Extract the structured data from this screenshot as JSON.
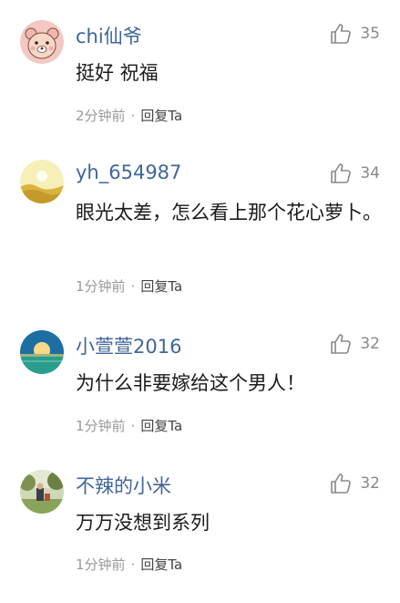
{
  "comments": [
    {
      "username": "chi仙爷",
      "likes": "35",
      "content": "挺好 祝福",
      "time": "2分钟前",
      "reply_label": "回复Ta",
      "avatar_icon": "cartoon-bear-avatar-icon"
    },
    {
      "username": "yh_654987",
      "likes": "34",
      "content": "眼光太差，怎么看上那个花心萝卜。",
      "time": "1分钟前",
      "reply_label": "回复Ta",
      "avatar_icon": "desert-sun-avatar-icon"
    },
    {
      "username": "小萱萱2016",
      "likes": "32",
      "content": "为什么非要嫁给这个男人！",
      "time": "1分钟前",
      "reply_label": "回复Ta",
      "avatar_icon": "sunset-sea-avatar-icon"
    },
    {
      "username": "不辣的小米",
      "likes": "32",
      "content": "万万没想到系列",
      "time": "1分钟前",
      "reply_label": "回复Ta",
      "avatar_icon": "outdoor-photo-avatar-icon"
    }
  ],
  "colors": {
    "username": "#406599",
    "meta": "#999999",
    "reply": "#444444",
    "text": "#1a1a1a"
  }
}
